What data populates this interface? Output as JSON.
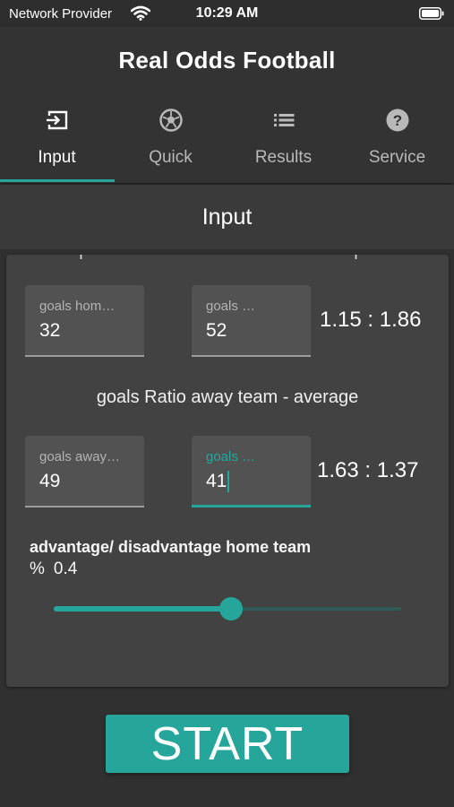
{
  "status_bar": {
    "carrier": "Network Provider",
    "time": "10:29 AM"
  },
  "app": {
    "title": "Real Odds Football"
  },
  "tabs": [
    {
      "label": "Input",
      "icon": "input-icon",
      "active": true
    },
    {
      "label": "Quick",
      "icon": "soccer-ball-icon",
      "active": false
    },
    {
      "label": "Results",
      "icon": "list-icon",
      "active": false
    },
    {
      "label": "Service",
      "icon": "help-icon",
      "active": false
    }
  ],
  "section": {
    "title": "Input"
  },
  "home_ratio": {
    "field1_label": "goals hom…",
    "field1_value": "32",
    "field2_label": "goals …",
    "field2_value": "52",
    "ratio": "1.15 : 1.86"
  },
  "away_ratio": {
    "label": "goals Ratio away team -  average",
    "field1_label": "goals away…",
    "field1_value": "49",
    "field2_label": "goals …",
    "field2_value": "41",
    "ratio": "1.63 : 1.37"
  },
  "advantage": {
    "label": "advantage/ disadvantage  home team",
    "unit": "%",
    "value": "0.4",
    "slider_fraction": 0.51
  },
  "start_button": {
    "label": "START"
  },
  "colors": {
    "accent": "#26a69a",
    "background": "#303030",
    "card": "#424242"
  }
}
